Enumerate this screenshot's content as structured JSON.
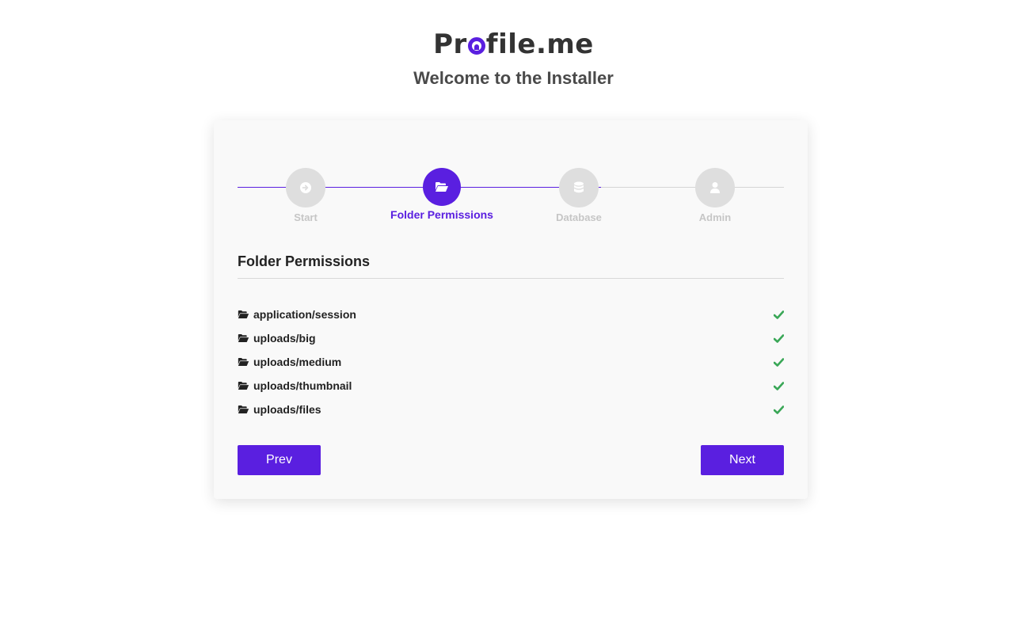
{
  "brand": {
    "name_start": "Pr",
    "name_end": "file.me",
    "accent": "#5a1fe0"
  },
  "header": {
    "welcome": "Welcome to the Installer"
  },
  "steps": [
    {
      "label": "Start",
      "icon": "arrow-right-circle-icon",
      "state": "completed"
    },
    {
      "label": "Folder Permissions",
      "icon": "folder-open-icon",
      "state": "active"
    },
    {
      "label": "Database",
      "icon": "database-icon",
      "state": "pending"
    },
    {
      "label": "Admin",
      "icon": "user-icon",
      "state": "pending"
    }
  ],
  "section": {
    "title": "Folder Permissions"
  },
  "folders": [
    {
      "path": "application/session",
      "status": "ok"
    },
    {
      "path": "uploads/big",
      "status": "ok"
    },
    {
      "path": "uploads/medium",
      "status": "ok"
    },
    {
      "path": "uploads/thumbnail",
      "status": "ok"
    },
    {
      "path": "uploads/files",
      "status": "ok"
    }
  ],
  "buttons": {
    "prev": "Prev",
    "next": "Next"
  },
  "colors": {
    "check": "#3aa757",
    "inactive_step": "#dedede",
    "inactive_label": "#c6c6c6"
  }
}
